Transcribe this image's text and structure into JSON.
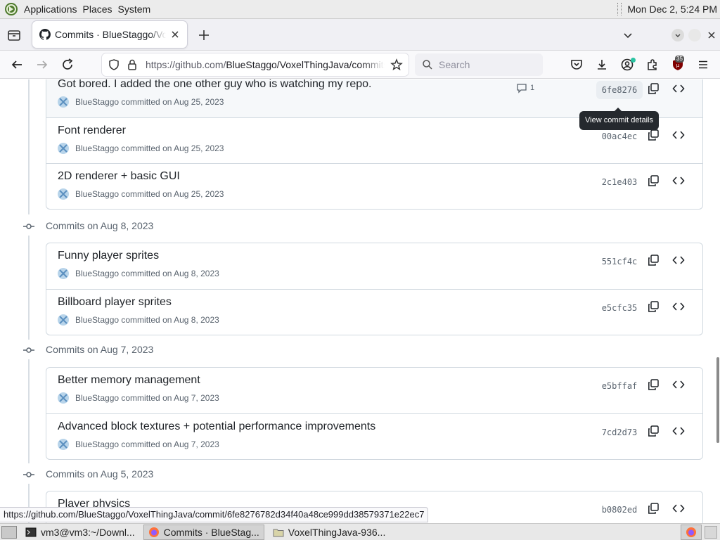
{
  "panel": {
    "menus": [
      "Applications",
      "Places",
      "System"
    ],
    "clock": "Mon Dec  2,  5:24 PM"
  },
  "tab": {
    "title": "Commits · BlueStaggo/VoxelThingJava"
  },
  "urlbar": {
    "prefix": "https://github.com/",
    "rest": "BlueStaggo/VoxelThingJava/commits"
  },
  "search": {
    "placeholder": "Search"
  },
  "extensions": {
    "ublock_badge": "35"
  },
  "tooltip": "View commit details",
  "groups": [
    {
      "heading": "",
      "commits": [
        {
          "message": "Got bored. I added the one other guy who is watching my repo.",
          "meta": "BlueStaggo committed on Aug 25, 2023",
          "sha": "6fe8276",
          "comments": "1"
        },
        {
          "message": "Font renderer",
          "meta": "BlueStaggo committed on Aug 25, 2023",
          "sha": "00ac4ec"
        },
        {
          "message": "2D renderer + basic GUI",
          "meta": "BlueStaggo committed on Aug 25, 2023",
          "sha": "2c1e403"
        }
      ]
    },
    {
      "heading": "Commits on Aug 8, 2023",
      "commits": [
        {
          "message": "Funny player sprites",
          "meta": "BlueStaggo committed on Aug 8, 2023",
          "sha": "551cf4c"
        },
        {
          "message": "Billboard player sprites",
          "meta": "BlueStaggo committed on Aug 8, 2023",
          "sha": "e5cfc35"
        }
      ]
    },
    {
      "heading": "Commits on Aug 7, 2023",
      "commits": [
        {
          "message": "Better memory management",
          "meta": "BlueStaggo committed on Aug 7, 2023",
          "sha": "e5bffaf"
        },
        {
          "message": "Advanced block textures + potential performance improvements",
          "meta": "BlueStaggo committed on Aug 7, 2023",
          "sha": "7cd2d73"
        }
      ]
    },
    {
      "heading": "Commits on Aug 5, 2023",
      "commits": [
        {
          "message": "Player physics",
          "meta": "",
          "sha": "b0802ed"
        }
      ]
    }
  ],
  "status_url": "https://github.com/BlueStaggo/VoxelThingJava/commit/6fe8276782d34f40a48ce999dd38579371e22ec7",
  "taskbar": {
    "tasks": [
      {
        "label": "vm3@vm3:~/Downl...",
        "icon": "terminal-icon"
      },
      {
        "label": "Commits · BlueStag...",
        "icon": "firefox-icon",
        "active": true
      },
      {
        "label": "VoxelThingJava-936...",
        "icon": "folder-icon"
      }
    ]
  },
  "colors": {
    "accent": "#0969da",
    "tooltip_bg": "#25292e",
    "border": "#d1d9e0",
    "muted": "#59636e"
  }
}
